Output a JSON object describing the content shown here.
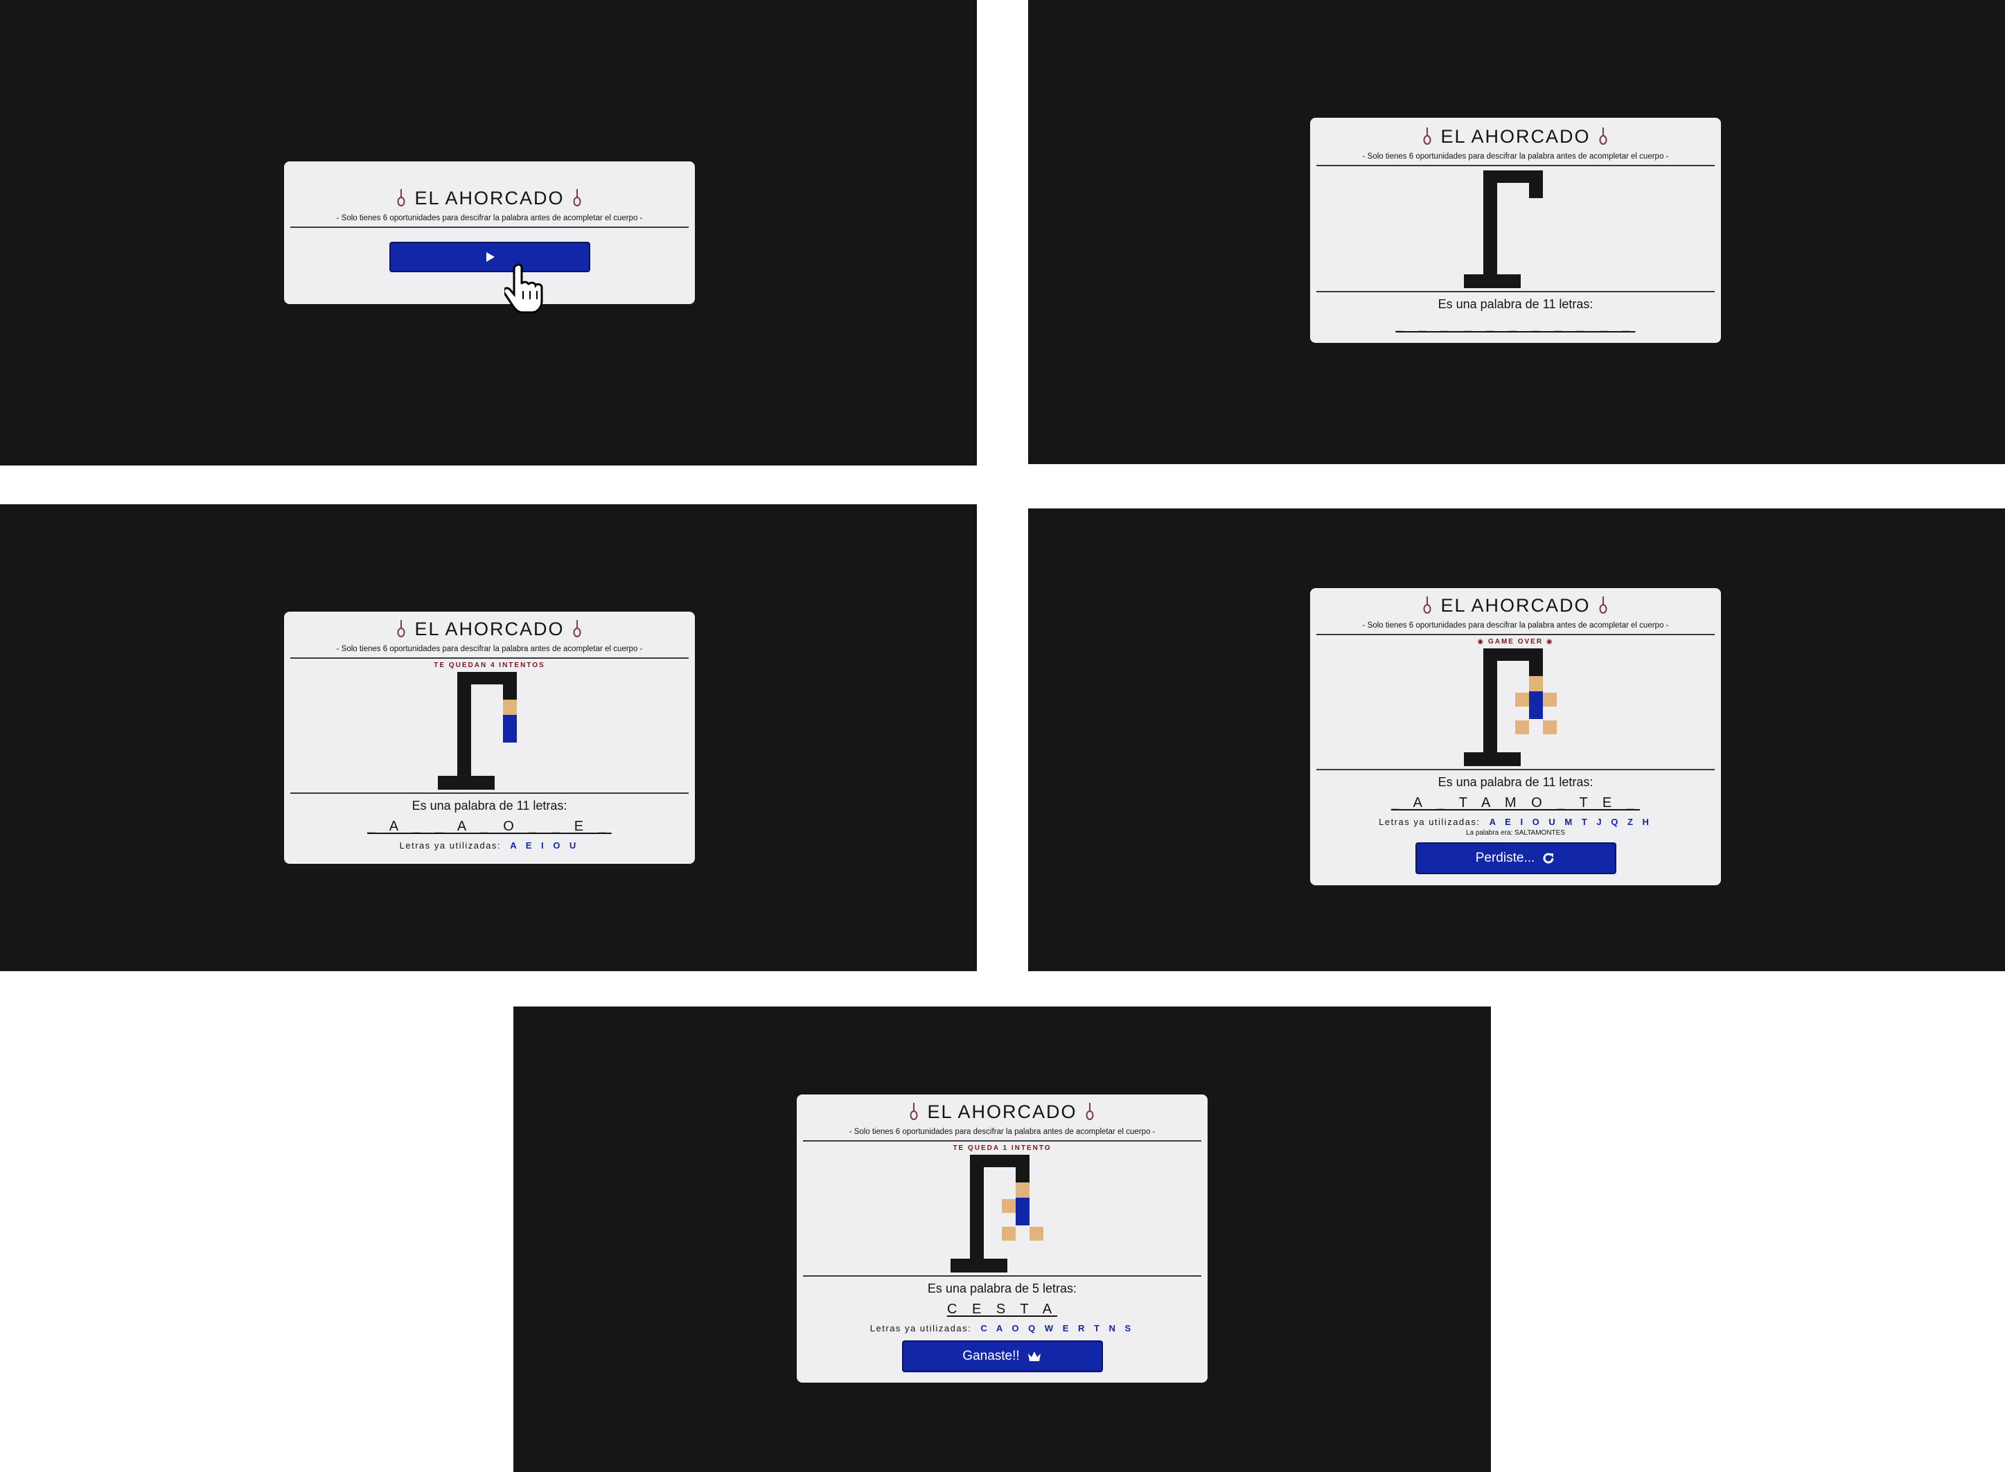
{
  "game": {
    "title": "EL AHORCADO",
    "subtitle": "- Solo tienes 6 oportunidades para descifrar la palabra antes de acompletar el cuerpo -",
    "used_label": "Letras ya utilizadas:"
  },
  "colors": {
    "background": "#161616",
    "card": "#efeff1",
    "accent": "#1227a8",
    "status": "#7d1416",
    "skin": "#e2b37a"
  },
  "screens": [
    {
      "name": "start",
      "play_button_icon": "play-icon"
    },
    {
      "name": "new-game",
      "word_info": "Es una palabra de 11 letras:",
      "blanks": "_ _ _ _ _ _ _ _ _ _ _",
      "attempts_used": 0
    },
    {
      "name": "in-progress",
      "status": "TE QUEDAN 4 INTENTOS",
      "word_info": "Es una palabra de 11 letras:",
      "blanks": "_ A _ _ A _ O _ _ E _",
      "used_letters": "A E I O U",
      "attempts_used": 2
    },
    {
      "name": "lost",
      "status": "GAME OVER",
      "word_info": "Es una palabra de 11 letras:",
      "blanks": "_ A _ T A M O _ T E _",
      "used_letters": "A E I O U M T J Q Z H",
      "reveal": "La palabra era: SALTAMONTES",
      "button_label": "Perdiste...",
      "button_icon": "refresh-icon",
      "attempts_used": 6
    },
    {
      "name": "won",
      "status": "TE QUEDA 1 INTENTO",
      "word_info": "Es una palabra de 5 letras:",
      "blanks": "C E S T A",
      "used_letters": "C A O Q W E R T N S",
      "button_label": "Ganaste!!",
      "button_icon": "crown-icon",
      "attempts_used": 5
    }
  ]
}
